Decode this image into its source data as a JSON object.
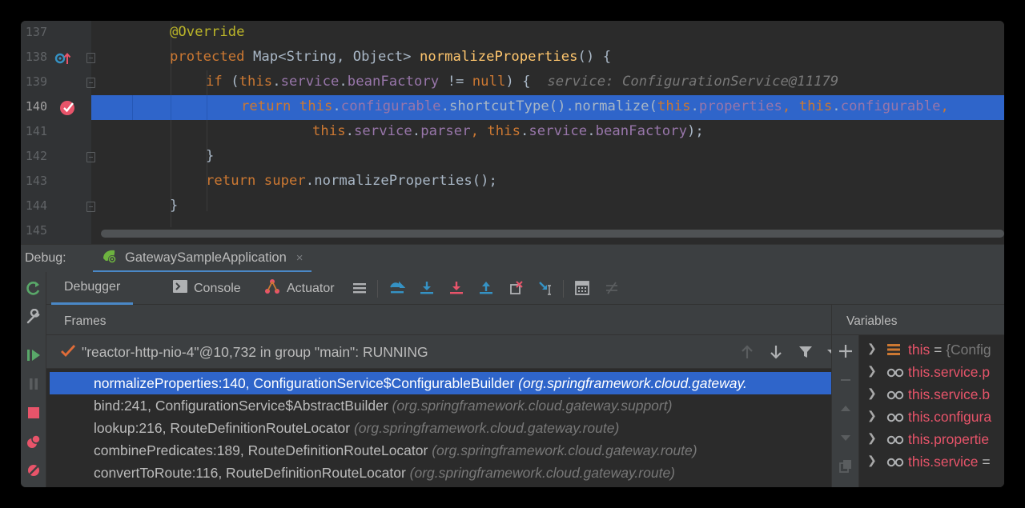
{
  "editor": {
    "lines": [
      {
        "num": "137"
      },
      {
        "num": "138"
      },
      {
        "num": "139"
      },
      {
        "num": "140"
      },
      {
        "num": "141"
      },
      {
        "num": "142"
      },
      {
        "num": "143"
      },
      {
        "num": "144"
      },
      {
        "num": "145"
      }
    ],
    "tokens": {
      "override": "@Override",
      "protected": "protected",
      "map_sig": " Map<String, Object> ",
      "method_name": "normalizeProperties",
      "parens_brace": "() {",
      "if_kw": "if",
      "if_open": " (",
      "this1": "this",
      "service1": "service",
      "beanFactory1": "beanFactory",
      "neq": " != ",
      "null_kw": "null",
      "if_close": ") {",
      "inline_hint": "service: ConfigurationService@11179",
      "return1": "return",
      "this2": "this",
      "configurable1": "configurable",
      "shortcut": ".shortcutType().normalize(",
      "this3": "this",
      "properties": "properties",
      "this4": "this",
      "configurable2": "configurable",
      "this5": "this",
      "service2": "service",
      "parser": "parser",
      "this6": "this",
      "service3": "service",
      "beanFactory2": "beanFactory",
      "end_call": ");",
      "close_brace1": "}",
      "return2": "return",
      "super_kw": "super",
      "super_call": ".normalizeProperties();",
      "close_brace2": "}"
    }
  },
  "debug": {
    "label": "Debug:",
    "run_config": "GatewaySampleApplication",
    "close": "×",
    "tabs": {
      "debugger": "Debugger",
      "console": "Console",
      "actuator": "Actuator"
    },
    "frames_title": "Frames",
    "thread": "\"reactor-http-nio-4\"@10,732 in group \"main\": RUNNING",
    "frames": [
      {
        "method": "normalizeProperties:140, ConfigurationService$ConfigurableBuilder",
        "pkg": "(org.springframework.cloud.gateway.",
        "selected": true
      },
      {
        "method": "bind:241, ConfigurationService$AbstractBuilder",
        "pkg": "(org.springframework.cloud.gateway.support)",
        "selected": false
      },
      {
        "method": "lookup:216, RouteDefinitionRouteLocator",
        "pkg": "(org.springframework.cloud.gateway.route)",
        "selected": false
      },
      {
        "method": "combinePredicates:189, RouteDefinitionRouteLocator",
        "pkg": "(org.springframework.cloud.gateway.route)",
        "selected": false
      },
      {
        "method": "convertToRoute:116, RouteDefinitionRouteLocator",
        "pkg": "(org.springframework.cloud.gateway.route)",
        "selected": false
      }
    ],
    "variables_title": "Variables",
    "variables": [
      {
        "name": "this",
        "eq": " = ",
        "value": "{Config",
        "icon": "field-list-icon"
      },
      {
        "name": "this.service.p",
        "eq": "",
        "value": "",
        "icon": "watch-glasses-icon"
      },
      {
        "name": "this.service.b",
        "eq": "",
        "value": "",
        "icon": "watch-glasses-icon"
      },
      {
        "name": "this.configura",
        "eq": "",
        "value": "",
        "icon": "watch-glasses-icon"
      },
      {
        "name": "this.propertie",
        "eq": "",
        "value": "",
        "icon": "watch-glasses-icon"
      },
      {
        "name": "this.service",
        "eq": " =",
        "value": "",
        "icon": "watch-glasses-icon"
      }
    ]
  },
  "colors": {
    "selection": "#2f65ca",
    "keyword": "#cc7832",
    "field": "#9876aa",
    "method": "#ffc66d",
    "annotation": "#bbb529",
    "error_red": "#e8546a",
    "accent_blue": "#4a88c7"
  }
}
